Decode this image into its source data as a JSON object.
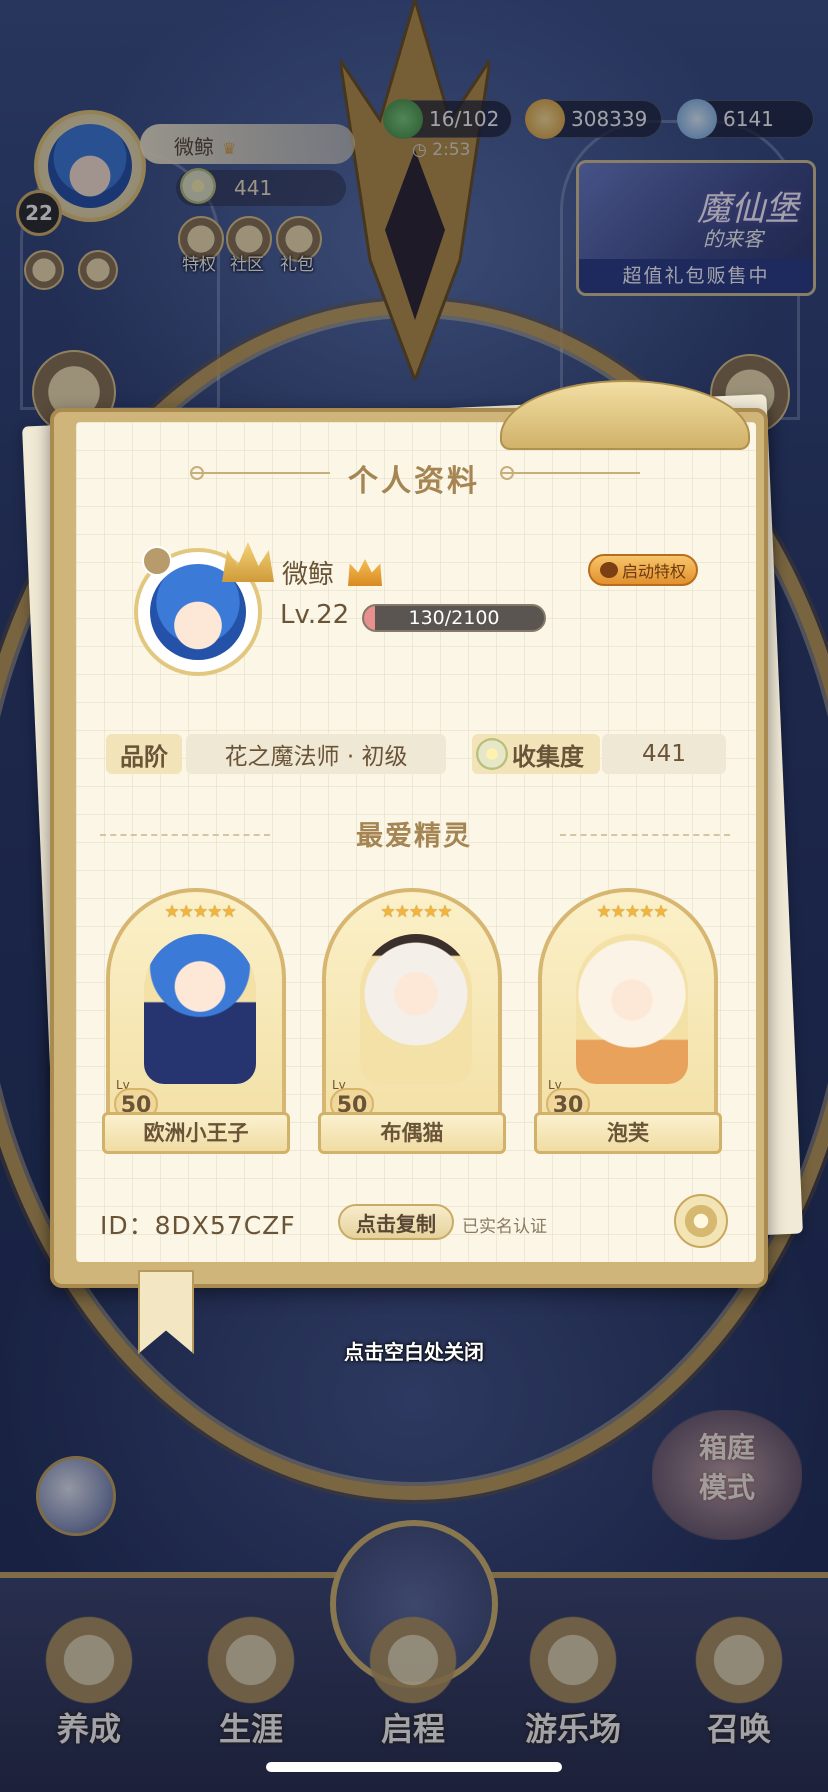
{
  "hud": {
    "player_name": "微鲸",
    "player_level": "22",
    "collection_value": "441",
    "quick_links": [
      {
        "label": "特权",
        "icon": "crown-icon"
      },
      {
        "label": "社区",
        "icon": "mask-icon"
      },
      {
        "label": "礼包",
        "icon": "gift-chat-icon"
      }
    ],
    "stamina": "16/102",
    "stamina_timer": "2:53",
    "gold": "308339",
    "gems": "6141",
    "gift_banner": {
      "title": "魔仙堡",
      "subtitle": "的来客",
      "cta": "超值礼包贩售中"
    }
  },
  "profile": {
    "title": "个人资料",
    "name": "微鲸",
    "level_text": "Lv.22",
    "exp_text": "130/2100",
    "exp_fraction": 0.062,
    "privilege_button": "启动特权",
    "rank_label": "品阶",
    "rank_value": "花之魔法师 · 初级",
    "collection_label": "收集度",
    "collection_value": "441",
    "favorites_title": "最爱精灵",
    "favorites": [
      {
        "name": "欧洲小王子",
        "level": "50",
        "lv_tag": "Lv",
        "stars": "★★★★★"
      },
      {
        "name": "布偶猫",
        "level": "50",
        "lv_tag": "Lv",
        "stars": "★★★★★"
      },
      {
        "name": "泡芙",
        "level": "30",
        "lv_tag": "Lv",
        "stars": "★★★★★"
      }
    ],
    "id_text": "ID：8DX57CZF",
    "copy_button": "点击复制",
    "verified_text": "已实名认证"
  },
  "close_hint": "点击空白处关闭",
  "garden_mode": {
    "line1": "箱庭",
    "line2": "模式"
  },
  "bottom_nav": [
    {
      "label": "养成",
      "icon": "girl-face-icon"
    },
    {
      "label": "生涯",
      "icon": "crown-icon"
    },
    {
      "label": "启程",
      "icon": "magic-book-icon"
    },
    {
      "label": "游乐场",
      "icon": "star-shield-icon"
    },
    {
      "label": "召唤",
      "icon": "summon-card-icon"
    }
  ],
  "colors": {
    "panel_bg": "#fbf6e6",
    "gold_accent": "#d6b670",
    "text_brown": "#6a5437",
    "exp_fill": "#e88f8f"
  }
}
